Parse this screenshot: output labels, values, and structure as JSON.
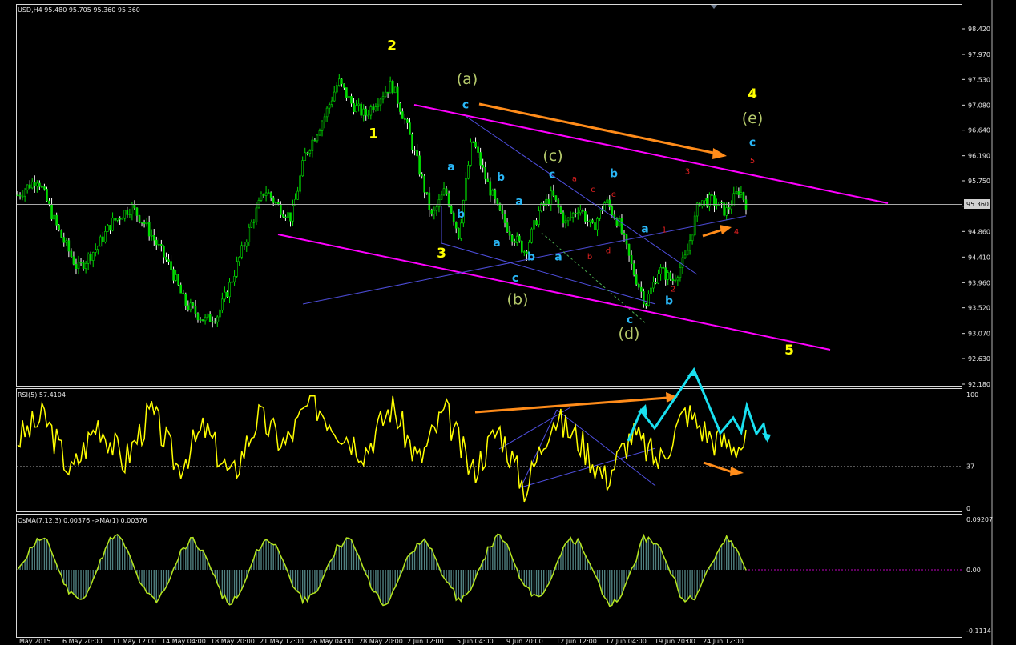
{
  "header": {
    "main": "USD,H4  95.480 95.705 95.360 95.360",
    "rsi": "RSI(5) 57.4104",
    "osma": "OsMA(7,12,3) 0.00376  ->MA(1) 0.00376"
  },
  "colors": {
    "background": "#000000",
    "frame": "#d9d9d9",
    "bull_candle": "#00dd00",
    "bear_candle": "#ffffff",
    "current_price_line": "#a8a8a8",
    "channel": "#ff00ff",
    "blue_line": "#4f4fe0",
    "rsi": "#ffff00",
    "rsi_level": "#a8a8a8",
    "osma_line": "#b5e61d",
    "osma_hist": "#4f7f7f",
    "wave_yellow": "#ffff00",
    "wave_olive": "#b5c96b",
    "wave_cyan": "#29b6f6",
    "wave_red": "#e02020",
    "arrow_orange": "#ff8c1a",
    "arrow_cyan": "#19e0f0"
  },
  "chart_data": {
    "type": "candlestick",
    "symbol": "USD",
    "timeframe": "H4",
    "ohlc_header": {
      "open": 95.48,
      "high": 95.705,
      "low": 95.36,
      "close": 95.36
    },
    "current_price": "95.360",
    "y_ticks": [
      "98.420",
      "97.970",
      "97.530",
      "97.080",
      "96.640",
      "96.190",
      "95.750",
      "95.305",
      "94.860",
      "94.410",
      "93.960",
      "93.520",
      "93.070",
      "92.630",
      "92.180"
    ],
    "ylim": [
      92.18,
      98.42
    ],
    "x_ticks": [
      "May 2015",
      "6 May 20:00",
      "11 May 12:00",
      "14 May 04:00",
      "18 May 20:00",
      "21 May 12:00",
      "26 May 04:00",
      "28 May 20:00",
      "2 Jun 12:00",
      "5 Jun 04:00",
      "9 Jun 20:00",
      "12 Jun 12:00",
      "17 Jun 04:00",
      "19 Jun 20:00",
      "24 Jun 12:00"
    ],
    "price_path": [
      [
        0,
        95.5
      ],
      [
        3,
        95.8
      ],
      [
        6,
        94.9
      ],
      [
        9,
        94.2
      ],
      [
        12,
        94.6
      ],
      [
        14,
        95.0
      ],
      [
        17,
        95.3
      ],
      [
        19,
        95.0
      ],
      [
        21,
        94.6
      ],
      [
        23,
        94.2
      ],
      [
        25,
        93.6
      ],
      [
        28,
        93.3
      ],
      [
        30,
        93.4
      ],
      [
        32,
        94.0
      ],
      [
        35,
        95.0
      ],
      [
        37,
        95.6
      ],
      [
        39,
        95.3
      ],
      [
        41,
        95.1
      ],
      [
        43,
        96.2
      ],
      [
        46,
        96.9
      ],
      [
        48,
        97.5
      ],
      [
        50,
        97.1
      ],
      [
        52,
        96.9
      ],
      [
        54,
        97.2
      ],
      [
        56,
        97.45
      ],
      [
        58,
        96.8
      ],
      [
        60,
        96.0
      ],
      [
        62,
        95.1
      ],
      [
        64,
        95.6
      ],
      [
        66,
        94.8
      ],
      [
        68,
        96.5
      ],
      [
        70,
        95.8
      ],
      [
        72,
        95.2
      ],
      [
        74,
        94.8
      ],
      [
        76,
        94.5
      ],
      [
        78,
        95.2
      ],
      [
        80,
        95.5
      ],
      [
        82,
        95.0
      ],
      [
        84,
        95.3
      ],
      [
        86,
        94.9
      ],
      [
        88,
        95.4
      ],
      [
        90,
        95.0
      ],
      [
        92,
        94.2
      ],
      [
        94,
        93.6
      ],
      [
        96,
        94.2
      ],
      [
        98,
        94.0
      ],
      [
        100,
        94.4
      ],
      [
        102,
        95.4
      ],
      [
        104,
        95.4
      ],
      [
        106,
        95.2
      ],
      [
        108,
        95.6
      ],
      [
        109,
        95.36
      ]
    ],
    "wave_labels": [
      {
        "text": "2",
        "color": "yellow",
        "price": 98.05,
        "x": 489
      },
      {
        "text": "1",
        "color": "yellow",
        "price": 96.5,
        "x": 466
      },
      {
        "text": "3",
        "color": "yellow",
        "price": 94.4,
        "x": 551
      },
      {
        "text": "4",
        "color": "yellow",
        "price": 97.2,
        "x": 939
      },
      {
        "text": "5",
        "color": "yellow",
        "price": 92.7,
        "x": 985
      },
      {
        "text": "(a)",
        "color": "olive",
        "price": 97.45,
        "x": 583
      },
      {
        "text": "(b)",
        "color": "olive",
        "price": 93.58,
        "x": 646
      },
      {
        "text": "(c)",
        "color": "olive",
        "price": 96.1,
        "x": 690
      },
      {
        "text": "(d)",
        "color": "olive",
        "price": 92.98,
        "x": 785
      },
      {
        "text": "(e)",
        "color": "olive",
        "price": 96.76,
        "x": 939
      },
      {
        "text": "c",
        "color": "cyan",
        "price": 97.02,
        "x": 581
      },
      {
        "text": "a",
        "color": "cyan",
        "price": 95.93,
        "x": 563
      },
      {
        "text": "b",
        "color": "cyan",
        "price": 95.1,
        "x": 575
      },
      {
        "text": "b",
        "color": "cyan",
        "price": 95.75,
        "x": 625
      },
      {
        "text": "a",
        "color": "cyan",
        "price": 95.33,
        "x": 648
      },
      {
        "text": "a",
        "color": "cyan",
        "price": 94.6,
        "x": 620
      },
      {
        "text": "b",
        "color": "cyan",
        "price": 94.35,
        "x": 663
      },
      {
        "text": "a",
        "color": "cyan",
        "price": 94.35,
        "x": 697
      },
      {
        "text": "c",
        "color": "cyan",
        "price": 93.98,
        "x": 643
      },
      {
        "text": "c",
        "color": "cyan",
        "price": 95.8,
        "x": 689
      },
      {
        "text": "b",
        "color": "cyan",
        "price": 95.81,
        "x": 766
      },
      {
        "text": "a",
        "color": "cyan",
        "price": 94.84,
        "x": 805
      },
      {
        "text": "b",
        "color": "cyan",
        "price": 93.58,
        "x": 835
      },
      {
        "text": "c",
        "color": "cyan",
        "price": 93.25,
        "x": 786
      },
      {
        "text": "c",
        "color": "cyan",
        "price": 96.36,
        "x": 939
      },
      {
        "text": "a",
        "color": "red",
        "price": 95.74,
        "x": 717
      },
      {
        "text": "c",
        "color": "red",
        "price": 95.55,
        "x": 740
      },
      {
        "text": "e",
        "color": "red",
        "price": 95.47,
        "x": 766
      },
      {
        "text": "b",
        "color": "red",
        "price": 94.37,
        "x": 736
      },
      {
        "text": "d",
        "color": "red",
        "price": 94.48,
        "x": 759
      },
      {
        "text": "3",
        "color": "red",
        "price": 95.87,
        "x": 858
      },
      {
        "text": "5",
        "color": "red",
        "price": 96.06,
        "x": 939
      },
      {
        "text": "1",
        "color": "red",
        "price": 94.84,
        "x": 829
      },
      {
        "text": "2",
        "color": "red",
        "price": 93.8,
        "x": 840
      },
      {
        "text": "4",
        "color": "red",
        "price": 94.81,
        "x": 919
      }
    ]
  },
  "rsi_data": {
    "title": "RSI(5) 57.4104",
    "value": 57.4104,
    "levels": [
      37
    ],
    "ticks": [
      "100",
      "37",
      "0"
    ],
    "path": [
      [
        0,
        60
      ],
      [
        4,
        80
      ],
      [
        8,
        30
      ],
      [
        12,
        75
      ],
      [
        16,
        40
      ],
      [
        20,
        85
      ],
      [
        24,
        35
      ],
      [
        28,
        70
      ],
      [
        32,
        25
      ],
      [
        36,
        80
      ],
      [
        40,
        55
      ],
      [
        44,
        95
      ],
      [
        48,
        70
      ],
      [
        52,
        50
      ],
      [
        56,
        90
      ],
      [
        60,
        40
      ],
      [
        64,
        85
      ],
      [
        68,
        30
      ],
      [
        72,
        70
      ],
      [
        76,
        15
      ],
      [
        80,
        80
      ],
      [
        84,
        60
      ],
      [
        88,
        25
      ],
      [
        92,
        65
      ],
      [
        96,
        40
      ],
      [
        100,
        85
      ],
      [
        104,
        60
      ],
      [
        108,
        55
      ],
      [
        109,
        57
      ]
    ]
  },
  "osma_data": {
    "title": "OsMA(7,12,3) 0.00376  ->MA(1) 0.00376",
    "value": 0.00376,
    "ticks": [
      "0.09207",
      "0.00",
      "-0.1114"
    ]
  }
}
